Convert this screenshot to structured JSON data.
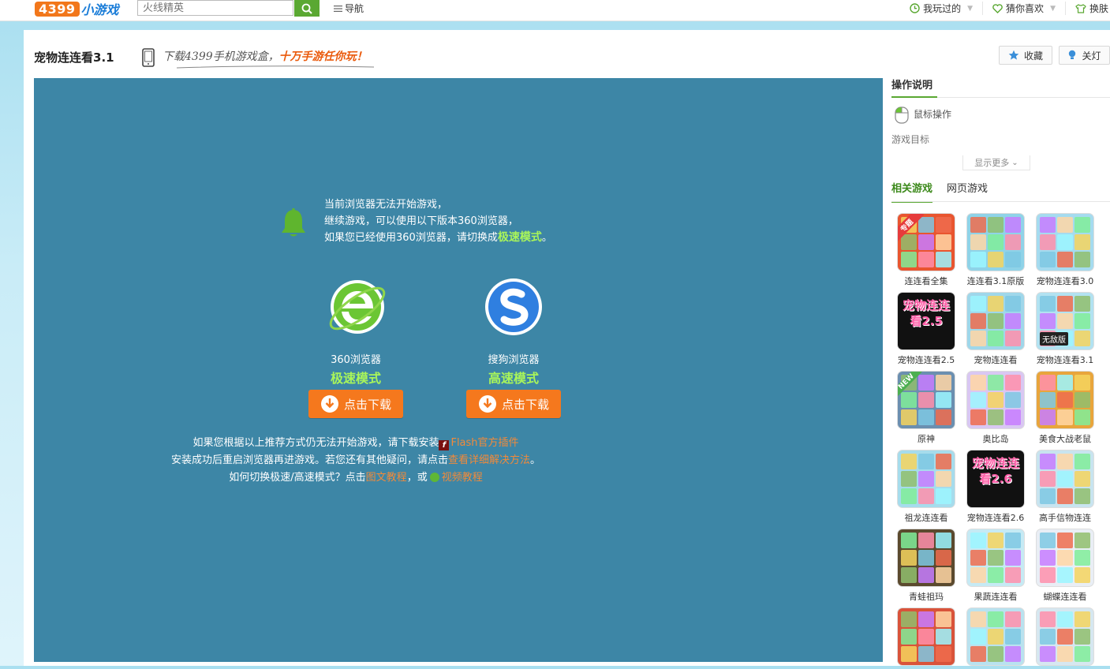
{
  "topbar": {
    "logo_num": "4399",
    "logo_text": "小游戏",
    "search_placeholder": "火线精英",
    "nav_label": "导航",
    "played_label": "我玩过的",
    "likes_label": "猜你喜欢",
    "skin_label": "换肤"
  },
  "header": {
    "title": "宠物连连看3.1",
    "promo_prefix": "下载4399手机游戏盒，",
    "promo_highlight": "十万手游任你玩！",
    "favorite_label": "收藏",
    "lights_label": "关灯"
  },
  "game": {
    "notice_line1": "当前浏览器无法开始游戏，",
    "notice_line2": "继续游戏，可以使用以下版本360浏览器，",
    "notice_line3_prefix": "如果您已经使用360浏览器，请切换成",
    "notice_line3_highlight": "极速模式",
    "notice_line3_suffix": "。",
    "browser1_name": "360浏览器",
    "browser1_mode": "极速模式",
    "browser2_name": "搜狗浏览器",
    "browser2_mode": "高速模式",
    "download_label": "点击下载",
    "note1_prefix": "如果您根据以上推荐方式仍无法开始游戏，请下载安装",
    "note1_link": "Flash官方插件",
    "note2_prefix": "安装成功后重启浏览器再进游戏。若您还有其他疑问，请点击",
    "note2_link": "查看详细解决方法",
    "note2_suffix": "。",
    "note3_prefix": "如何切换极速/高速模式？点击",
    "note3_link1": "图文教程",
    "note3_mid": "，或",
    "note3_link2": "视频教程"
  },
  "sidebar": {
    "instructions_title": "操作说明",
    "mouse_label": "鼠标操作",
    "goal_label": "游戏目标",
    "show_more": "显示更多",
    "tab_related": "相关游戏",
    "tab_web": "网页游戏",
    "games": [
      {
        "label": "连连看全集",
        "tag": "专题",
        "color": "#e9552f"
      },
      {
        "label": "连连看3.1原版",
        "color": "#8fd3e8"
      },
      {
        "label": "宠物连连看3.0",
        "color": "#a5dbef"
      },
      {
        "label": "宠物连连看2.5",
        "color": "#111111",
        "text": "宠物连连看2.5"
      },
      {
        "label": "宠物连连看",
        "color": "#9fd7ea"
      },
      {
        "label": "宠物连连看3.1",
        "color": "#b2e2f1",
        "tag2": "无敌版"
      },
      {
        "label": "原神",
        "tag": "NEW",
        "color": "#6b8fb0"
      },
      {
        "label": "奥比岛",
        "color": "#d9c7f2"
      },
      {
        "label": "美食大战老鼠",
        "color": "#e8a53c"
      },
      {
        "label": "祖龙连连看",
        "color": "#a6dcec"
      },
      {
        "label": "宠物连连看2.6",
        "color": "#111111",
        "text": "宠物连连看2.6"
      },
      {
        "label": "高手信物连连",
        "color": "#c8e4ef"
      },
      {
        "label": "青蛙祖玛",
        "color": "#5b4a2e"
      },
      {
        "label": "果蔬连连看",
        "color": "#c6eaf4"
      },
      {
        "label": "蝴蝶连连看",
        "color": "#e9eef5"
      },
      {
        "label": "",
        "color": "#d9533a"
      },
      {
        "label": "",
        "color": "#b9e2ef"
      },
      {
        "label": "",
        "color": "#d6e7f0"
      }
    ]
  },
  "colors": {
    "game_bg": "#3d86a6",
    "accent_green": "#a9f55a",
    "download_orange": "#f5781d",
    "brand_green": "#5aa832"
  }
}
